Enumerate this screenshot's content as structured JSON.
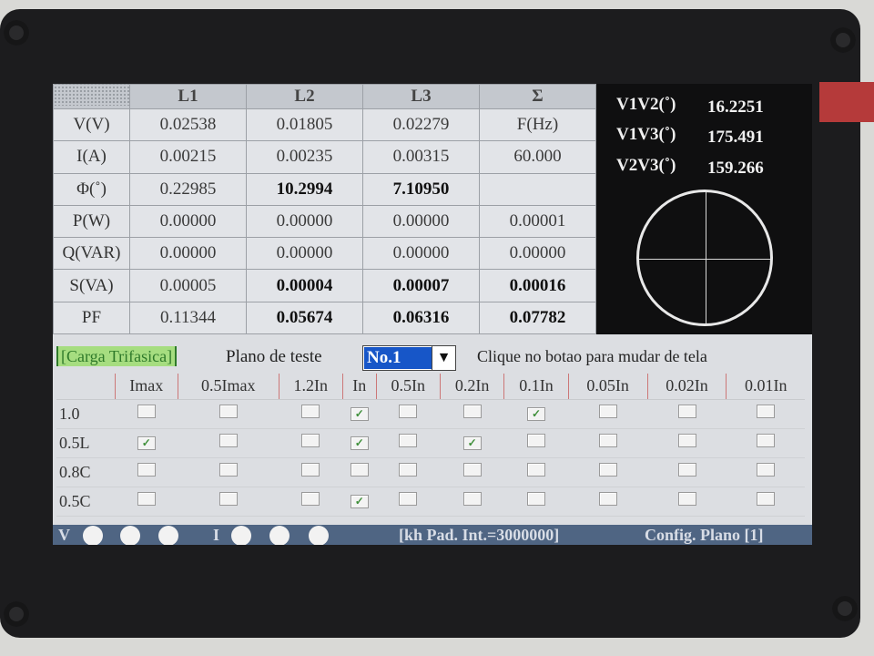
{
  "table": {
    "headers": [
      "",
      "L1",
      "L2",
      "L3",
      "Σ"
    ],
    "rows": [
      {
        "label": "V(V)",
        "cells": [
          "0.02538",
          "0.01805",
          "0.02279",
          "F(Hz)"
        ]
      },
      {
        "label": "I(A)",
        "cells": [
          "0.00215",
          "0.00235",
          "0.00315",
          "60.000"
        ]
      },
      {
        "label": "Φ(˚)",
        "cells": [
          "0.22985",
          "10.2994",
          "7.10950",
          ""
        ]
      },
      {
        "label": "P(W)",
        "cells": [
          "0.00000",
          "0.00000",
          "0.00000",
          "0.00001"
        ]
      },
      {
        "label": "Q(VAR)",
        "cells": [
          "0.00000",
          "0.00000",
          "0.00000",
          "0.00000"
        ]
      },
      {
        "label": "S(VA)",
        "cells": [
          "0.00005",
          "0.00004",
          "0.00007",
          "0.00016"
        ]
      },
      {
        "label": "PF",
        "cells": [
          "0.11344",
          "0.05674",
          "0.06316",
          "0.07782"
        ]
      }
    ]
  },
  "angles": [
    {
      "label": "V1V2(˚)",
      "value": "16.2251"
    },
    {
      "label": "V1V3(˚)",
      "value": "175.491"
    },
    {
      "label": "V2V3(˚)",
      "value": "159.266"
    }
  ],
  "lower": {
    "mode_label": "[Carga Trifasica]",
    "plano_label": "Plano de teste",
    "plano_value": "No.1",
    "hint": "Clique no botao para mudar de tela",
    "columns": [
      "Imax",
      "0.5Imax",
      "1.2In",
      "In",
      "0.5In",
      "0.2In",
      "0.1In",
      "0.05In",
      "0.02In",
      "0.01In"
    ],
    "rows": [
      {
        "label": "1.0",
        "checked": [
          false,
          false,
          false,
          true,
          false,
          false,
          true,
          false,
          false,
          false
        ]
      },
      {
        "label": "0.5L",
        "checked": [
          true,
          false,
          false,
          true,
          false,
          true,
          false,
          false,
          false,
          false
        ]
      },
      {
        "label": "0.8C",
        "checked": [
          false,
          false,
          false,
          false,
          false,
          false,
          false,
          false,
          false,
          false
        ]
      },
      {
        "label": "0.5C",
        "checked": [
          false,
          false,
          false,
          true,
          false,
          false,
          false,
          false,
          false,
          false
        ]
      }
    ]
  },
  "status": {
    "v_label": "V",
    "i_label": "I",
    "kh_text": "[kh Pad. Int.=3000000]",
    "config_text": "Config. Plano [1]"
  },
  "colors": {
    "mode_bg": "#a6dd80",
    "select_bg": "#1756c8",
    "status_bg": "#4f6583",
    "check": "#3f8f3a"
  }
}
